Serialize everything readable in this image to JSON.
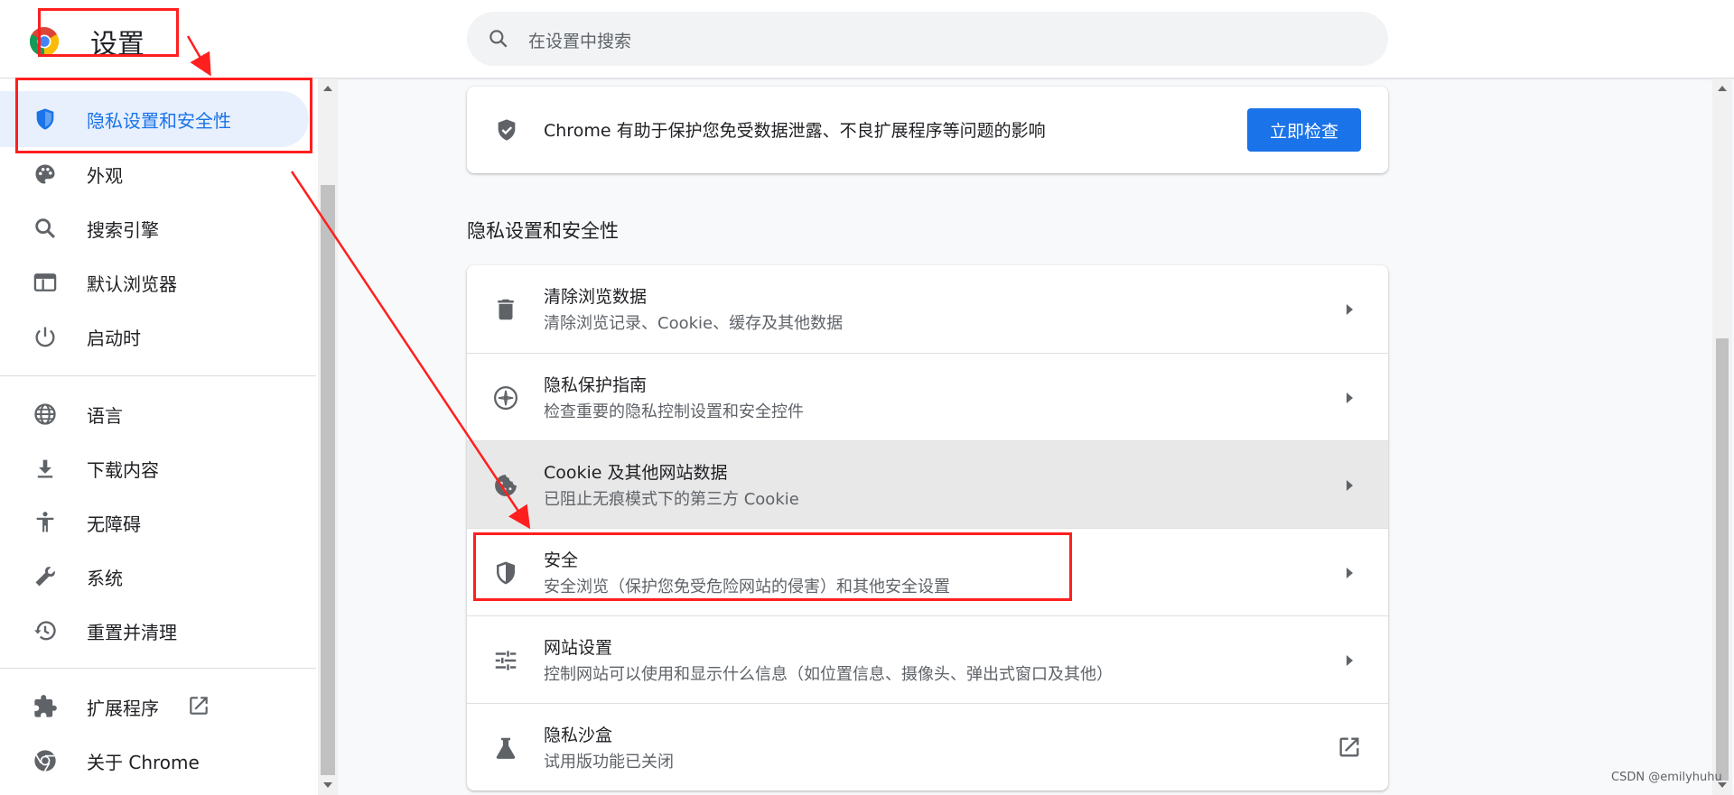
{
  "header": {
    "title": "设置",
    "search_placeholder": "在设置中搜索"
  },
  "sidebar": {
    "items": [
      {
        "label": "隐私设置和安全性",
        "icon": "shield-icon",
        "active": true
      },
      {
        "label": "外观",
        "icon": "palette-icon"
      },
      {
        "label": "搜索引擎",
        "icon": "search-icon"
      },
      {
        "label": "默认浏览器",
        "icon": "browser-window-icon"
      },
      {
        "label": "启动时",
        "icon": "power-icon"
      },
      {
        "label": "语言",
        "icon": "globe-icon"
      },
      {
        "label": "下载内容",
        "icon": "download-icon"
      },
      {
        "label": "无障碍",
        "icon": "accessibility-icon"
      },
      {
        "label": "系统",
        "icon": "wrench-icon"
      },
      {
        "label": "重置并清理",
        "icon": "history-icon"
      },
      {
        "label": "扩展程序",
        "icon": "puzzle-icon"
      },
      {
        "label": "关于 Chrome",
        "icon": "chrome-icon"
      }
    ]
  },
  "safety_check": {
    "description": "Chrome 有助于保护您免受数据泄露、不良扩展程序等问题的影响",
    "button_label": "立即检查"
  },
  "section": {
    "title": "隐私设置和安全性",
    "rows": [
      {
        "title": "清除浏览数据",
        "subtitle": "清除浏览记录、Cookie、缓存及其他数据",
        "icon": "trash-icon"
      },
      {
        "title": "隐私保护指南",
        "subtitle": "检查重要的隐私控制设置和安全控件",
        "icon": "compass-icon"
      },
      {
        "title": "Cookie 及其他网站数据",
        "subtitle": "已阻止无痕模式下的第三方 Cookie",
        "icon": "cookie-icon"
      },
      {
        "title": "安全",
        "subtitle": "安全浏览（保护您免受危险网站的侵害）和其他安全设置",
        "icon": "shield-icon"
      },
      {
        "title": "网站设置",
        "subtitle": "控制网站可以使用和显示什么信息（如位置信息、摄像头、弹出式窗口及其他）",
        "icon": "tune-icon"
      },
      {
        "title": "隐私沙盒",
        "subtitle": "试用版功能已关闭",
        "icon": "flask-icon"
      }
    ]
  },
  "watermark": "CSDN @emilyhuhu",
  "colors": {
    "accent": "#1a73e8",
    "annotation": "#ff1f1f"
  }
}
